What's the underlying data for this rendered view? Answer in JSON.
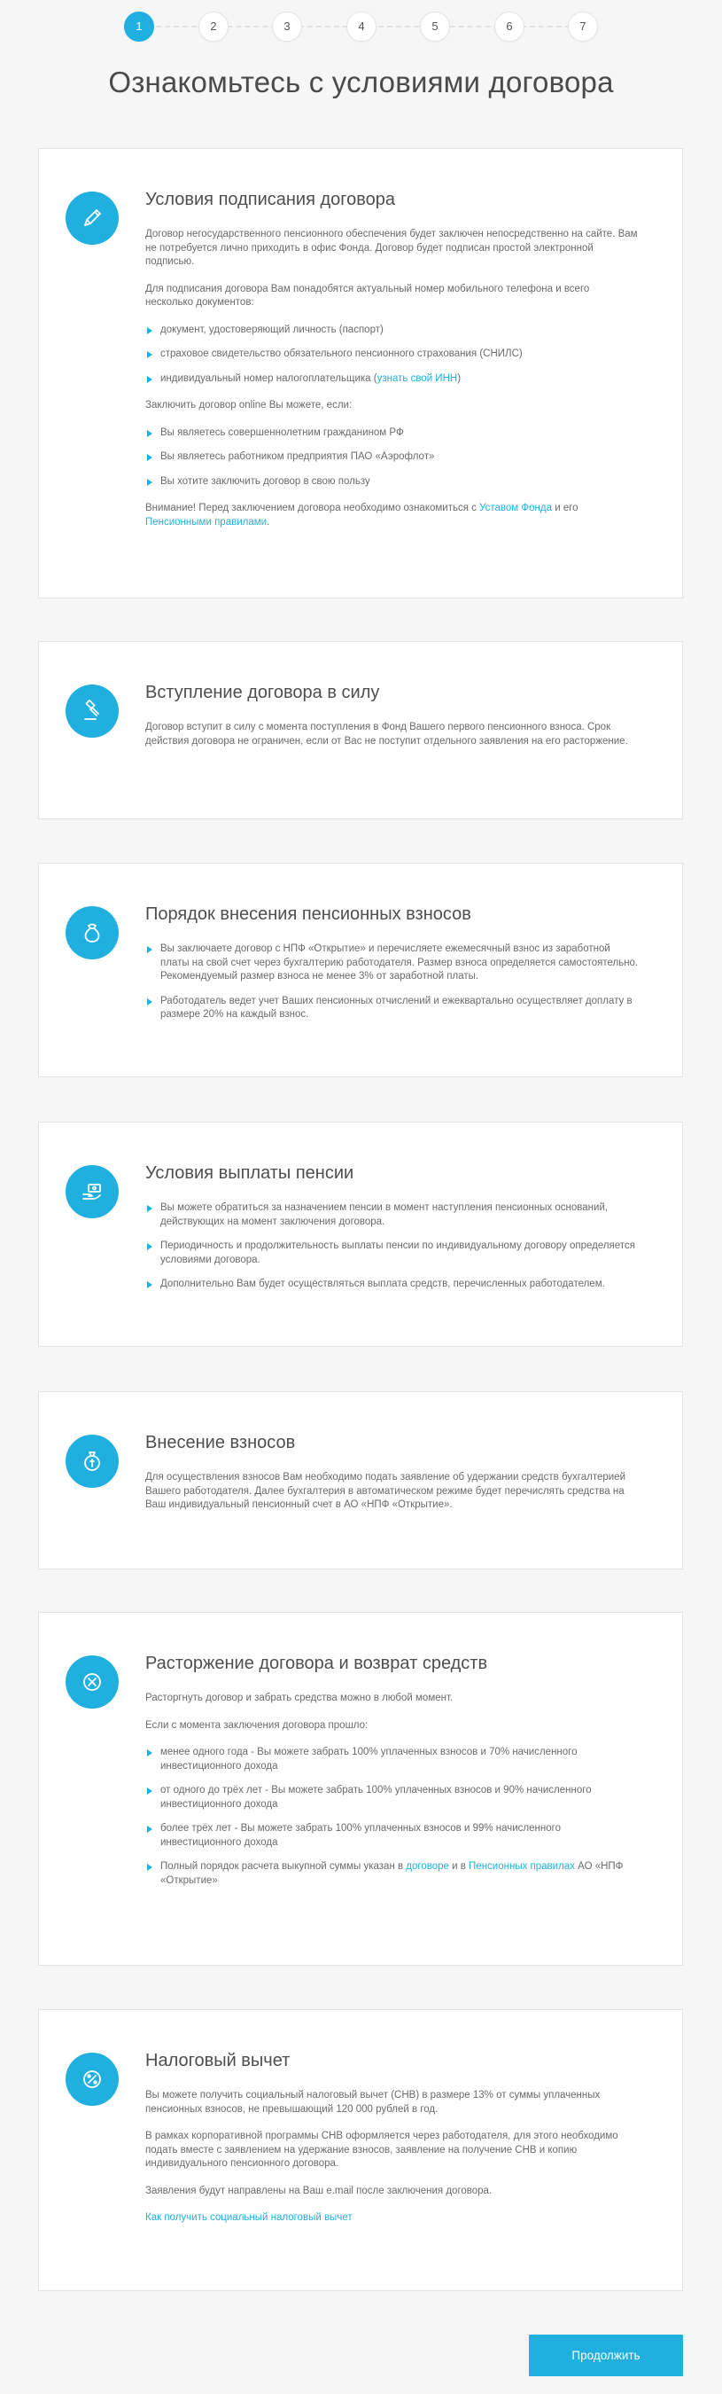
{
  "stepper": {
    "steps": [
      "1",
      "2",
      "3",
      "4",
      "5",
      "6",
      "7"
    ],
    "active": 1
  },
  "page": {
    "title": "Ознакомьтесь с условиями договора"
  },
  "sign": {
    "title": "Условия подписания договора",
    "p1": "Договор негосударственного пенсионного обеспечения будет заключен непосредственно на сайте. Вам не потребуется лично приходить в офис Фонда. Договор будет подписан простой электронной подписью.",
    "p2": "Для подписания договора Вам понадобятся актуальный номер мобильного телефона и всего несколько документов:",
    "docs": [
      "документ, удостоверяющий личность (паспорт)",
      "страховое свидетельство обязательного пенсионного страхования (СНИЛС)"
    ],
    "inn_text": "индивидуальный номер налогоплательщика (",
    "inn_link": "узнать свой ИНН",
    "inn_close": ")",
    "p3": "Заключить договор online Вы можете, если:",
    "conds": [
      "Вы являетесь совершеннолетним гражданином РФ",
      "Вы являетесь работником предприятия ПАО «Аэрофлот»",
      "Вы хотите заключить договор в свою пользу"
    ],
    "warn_text": "Внимание! Перед заключением договора необходимо ознакомиться с ",
    "warn_link1": "Уставом Фонда",
    "warn_and": " и его ",
    "warn_link2": "Пенсионными правилами",
    "warn_end": "."
  },
  "effect": {
    "title": "Вступление договора в силу",
    "p1": "Договор вступит в силу с момента поступления в Фонд Вашего первого пенсионного взноса. Срок действия договора не ограничен, если от Вас не поступит отдельного заявления на его расторжение."
  },
  "order": {
    "title": "Порядок внесения пенсионных взносов",
    "items": [
      "Вы заключаете договор с НПФ «Открытие» и перечисляете ежемесячный взнос из заработной платы на свой счет через бухгалтерию работодателя. Размер взноса определяется самостоятельно. Рекомендуемый размер взноса не менее 3% от заработной платы.",
      "Работодатель ведет учет Ваших пенсионных отчислений и ежеквартально осуществляет доплату в размере 20% на каждый взнос."
    ]
  },
  "payout": {
    "title": "Условия выплаты пенсии",
    "items": [
      "Вы можете обратиться за назначением пенсии в момент наступления пенсионных оснований, действующих на момент заключения договора.",
      "Периодичность и продолжительность выплаты пенсии по индивидуальному договору определяется условиями договора.",
      "Дополнительно Вам будет осуществляться выплата средств, перечисленных работодателем."
    ]
  },
  "deposit": {
    "title": "Внесение взносов",
    "p1": "Для осуществления взносов Вам необходимо подать заявление об удержании средств бухгалтерией Вашего работодателя. Далее бухгалтерия в автоматическом режиме будет перечислять средства на Ваш индивидуальный пенсионный счет в АО «НПФ «Открытие»."
  },
  "termination": {
    "title": "Расторжение договора и возврат средств",
    "p1": "Расторгнуть договор и забрать средства можно в любой момент.",
    "p2": "Если с момента заключения договора прошло:",
    "items": [
      "менее одного года - Вы можете забрать 100% уплаченных взносов и 70% начисленного инвестиционного дохода",
      "от одного до трёх лет - Вы можете забрать 100% уплаченных взносов и 90% начисленного инвестиционного дохода",
      "более трёх лет - Вы можете забрать 100% уплаченных взносов и 99% начисленного инвестиционного дохода"
    ],
    "last_text": "Полный порядок расчета выкупной суммы указан в ",
    "last_link1": "договоре",
    "last_and": " и в ",
    "last_link2": "Пенсионных правилах",
    "last_end": " АО «НПФ «Открытие»"
  },
  "tax": {
    "title": "Налоговый вычет",
    "p1": "Вы можете получить социальный налоговый вычет (СНВ) в размере 13% от суммы уплаченных пенсионных взносов, не превышающий 120 000 рублей в год.",
    "p2": "В рамках корпоративной программы СНВ оформляется через работодателя, для этого необходимо подать вместе с заявлением на удержание взносов, заявление на получение СНВ и копию индивидуального пенсионного договора.",
    "p3": "Заявления будут направлены на Ваш e.mail после заключения договора.",
    "link": "Как получить социальный налоговый вычет"
  },
  "actions": {
    "continue": "Продолжить"
  },
  "colors": {
    "accent": "#1fb0e0",
    "background": "#f6f6f6"
  }
}
